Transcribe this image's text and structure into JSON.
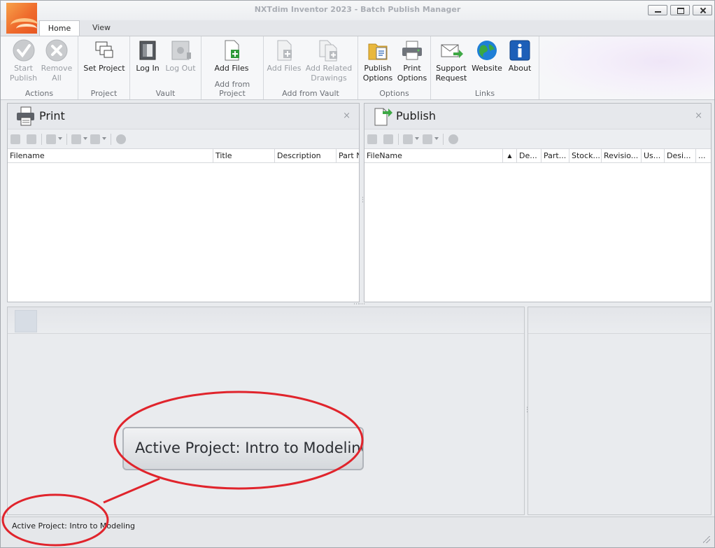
{
  "window": {
    "title": "NXTdim Inventor 2023 - Batch Publish Manager"
  },
  "tabs": [
    {
      "label": "Home"
    },
    {
      "label": "View"
    }
  ],
  "ribbon": {
    "groups": [
      {
        "label": "Actions",
        "buttons": [
          {
            "label": "Start\nPublish",
            "icon": "check-circle-icon",
            "enabled": false
          },
          {
            "label": "Remove\nAll",
            "icon": "x-circle-icon",
            "enabled": false
          }
        ]
      },
      {
        "label": "Project",
        "buttons": [
          {
            "label": "Set Project",
            "icon": "project-windows-icon",
            "enabled": true
          }
        ]
      },
      {
        "label": "Vault",
        "buttons": [
          {
            "label": "Log In",
            "icon": "vault-door-icon",
            "enabled": true
          },
          {
            "label": "Log Out",
            "icon": "vault-safe-icon",
            "enabled": false
          }
        ]
      },
      {
        "label": "Add from Project",
        "buttons": [
          {
            "label": "Add Files",
            "icon": "add-file-icon",
            "enabled": true
          }
        ]
      },
      {
        "label": "Add from Vault",
        "buttons": [
          {
            "label": "Add Files",
            "icon": "add-file-icon",
            "enabled": false
          },
          {
            "label": "Add Related\nDrawings",
            "icon": "add-related-icon",
            "enabled": false
          }
        ]
      },
      {
        "label": "Options",
        "buttons": [
          {
            "label": "Publish\nOptions",
            "icon": "publish-options-icon",
            "enabled": true
          },
          {
            "label": "Print\nOptions",
            "icon": "printer-icon",
            "enabled": true
          }
        ]
      },
      {
        "label": "Links",
        "buttons": [
          {
            "label": "Support\nRequest",
            "icon": "envelope-arrow-icon",
            "enabled": true
          },
          {
            "label": "Website",
            "icon": "globe-icon",
            "enabled": true
          },
          {
            "label": "About",
            "icon": "info-icon",
            "enabled": true
          }
        ]
      }
    ]
  },
  "print_panel": {
    "title": "Print",
    "close_glyph": "×",
    "columns": [
      "Filename",
      "Title",
      "Description",
      "Part N"
    ]
  },
  "publish_panel": {
    "title": "Publish",
    "close_glyph": "×",
    "columns": [
      "FileName",
      "▲",
      "De...",
      "Part...",
      "Stock...",
      "Revisio...",
      "Us...",
      "Desi...",
      "..."
    ]
  },
  "status": {
    "active_project": "Active Project: Intro to Modeling"
  },
  "callout": {
    "text": "Active Project: Intro to Modeling",
    "ring_color": "#e0242c"
  }
}
